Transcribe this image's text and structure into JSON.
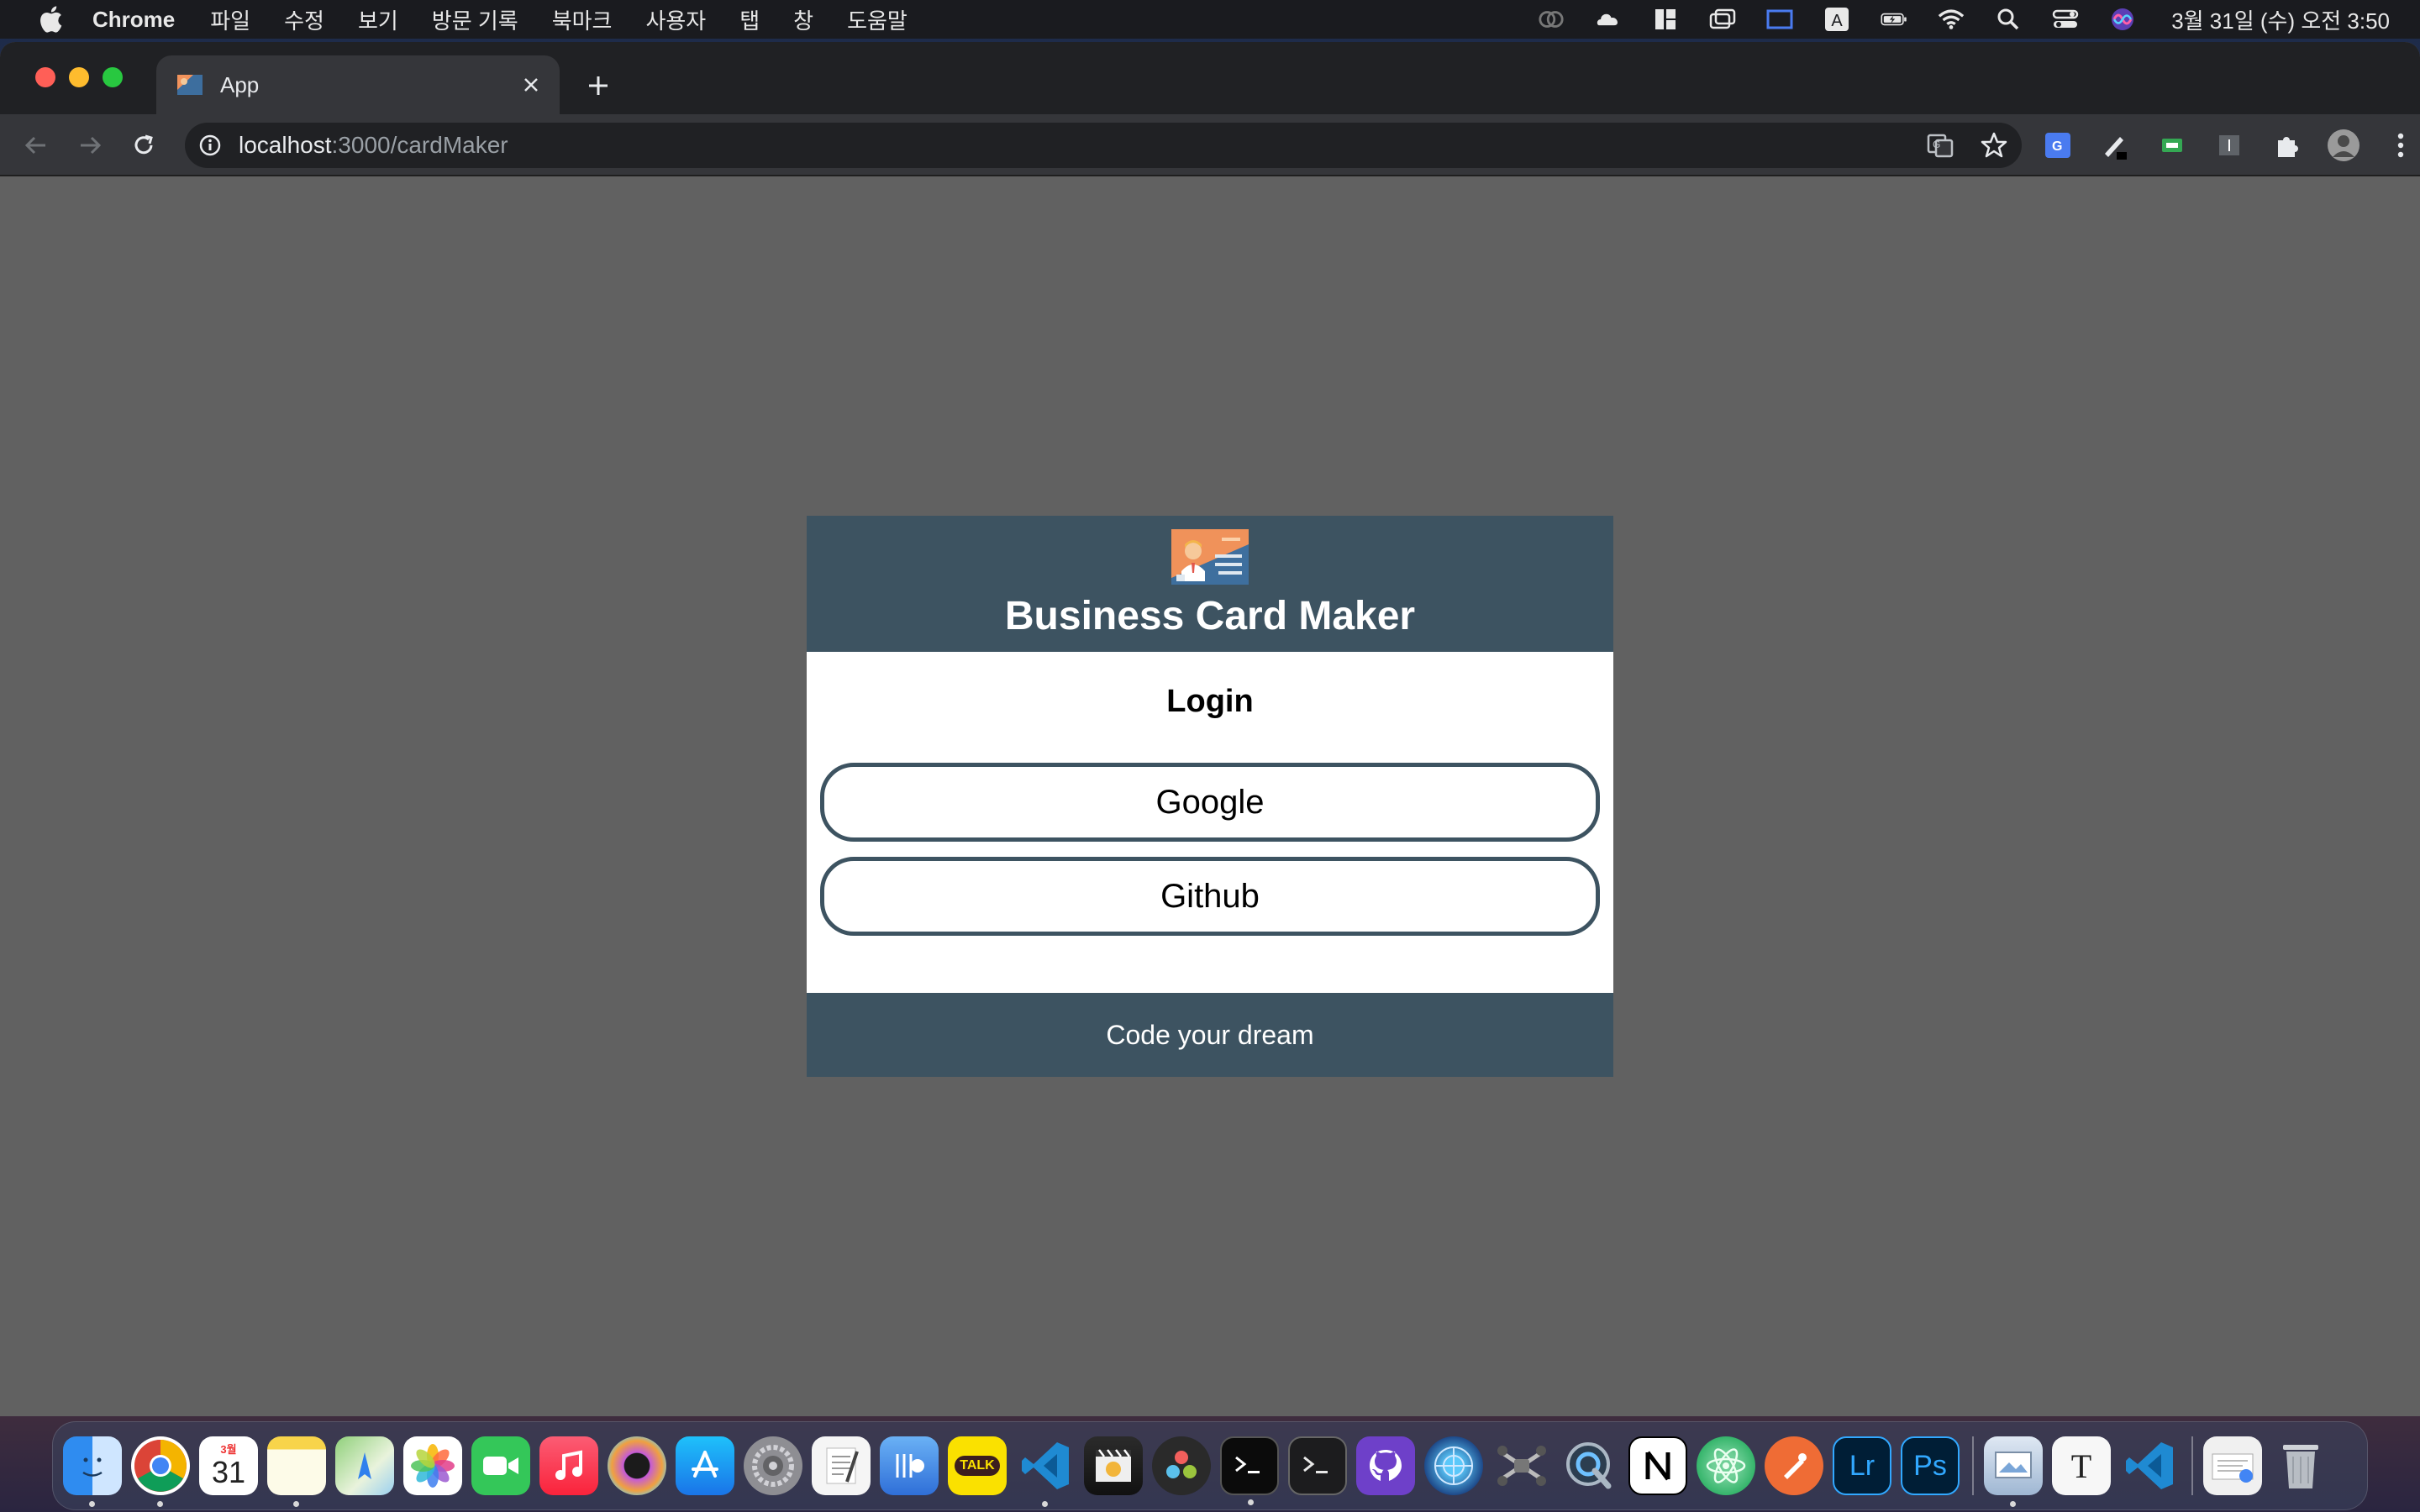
{
  "menubar": {
    "app_name": "Chrome",
    "items": [
      "파일",
      "수정",
      "보기",
      "방문 기록",
      "북마크",
      "사용자",
      "탭",
      "창",
      "도움말"
    ],
    "clock": "3월 31일 (수) 오전 3:50"
  },
  "browser": {
    "tab_title": "App",
    "url_host": "localhost",
    "url_rest": ":3000/cardMaker"
  },
  "card": {
    "app_title": "Business Card Maker",
    "login_heading": "Login",
    "google_label": "Google",
    "github_label": "Github",
    "footer_text": "Code your dream"
  },
  "dock": {
    "calendar_day": "31",
    "calendar_month": "3월",
    "lightroom_label": "Lr",
    "photoshop_label": "Ps",
    "typora_label": "T",
    "kakaotalk_label": "TALK"
  },
  "colors": {
    "card_header": "#3d5361",
    "page_background": "#616161",
    "button_border": "#3d5361"
  }
}
